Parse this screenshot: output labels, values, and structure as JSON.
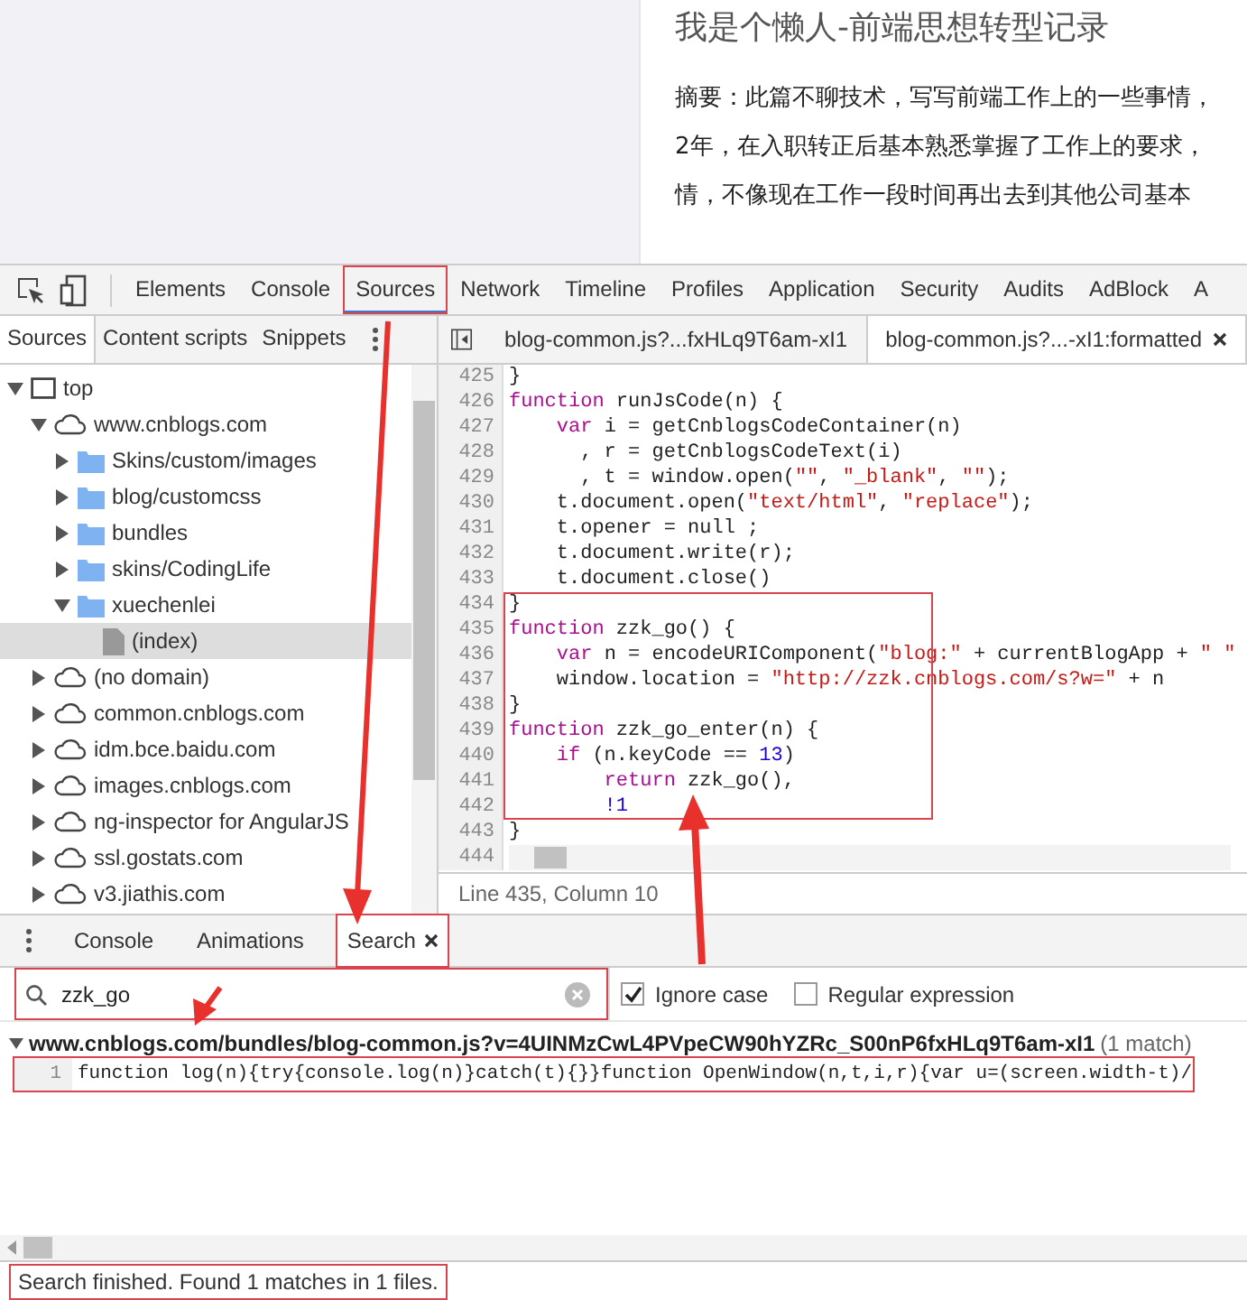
{
  "article": {
    "title": "我是个懒人-前端思想转型记录",
    "summary_lines": [
      "摘要：此篇不聊技术，写写前端工作上的一些事情，",
      "2年，在入职转正后基本熟悉掌握了工作上的要求，",
      "情，不像现在工作一段时间再出去到其他公司基本"
    ]
  },
  "panel_tabs": [
    {
      "label": "Elements",
      "selected": false,
      "highlighted": false
    },
    {
      "label": "Console",
      "selected": false,
      "highlighted": false
    },
    {
      "label": "Sources",
      "selected": true,
      "highlighted": true
    },
    {
      "label": "Network",
      "selected": false,
      "highlighted": false
    },
    {
      "label": "Timeline",
      "selected": false,
      "highlighted": false
    },
    {
      "label": "Profiles",
      "selected": false,
      "highlighted": false
    },
    {
      "label": "Application",
      "selected": false,
      "highlighted": false
    },
    {
      "label": "Security",
      "selected": false,
      "highlighted": false
    },
    {
      "label": "Audits",
      "selected": false,
      "highlighted": false
    },
    {
      "label": "AdBlock",
      "selected": false,
      "highlighted": false
    },
    {
      "label": "A",
      "selected": false,
      "highlighted": false
    }
  ],
  "navigator_tabs": [
    {
      "label": "Sources",
      "selected": true
    },
    {
      "label": "Content scripts",
      "selected": false
    },
    {
      "label": "Snippets",
      "selected": false
    }
  ],
  "editor_tabs": [
    {
      "label": "blog-common.js?...fxHLq9T6am-xI1",
      "selected": false,
      "closable": false
    },
    {
      "label": "blog-common.js?...-xI1:formatted",
      "selected": true,
      "closable": true
    }
  ],
  "tree": [
    {
      "label": "top",
      "kind": "frame",
      "expanded": true,
      "selected": false,
      "children": [
        {
          "label": "www.cnblogs.com",
          "kind": "domain",
          "expanded": true,
          "selected": false,
          "children": [
            {
              "label": "Skins/custom/images",
              "kind": "folder",
              "expanded": false,
              "selected": false
            },
            {
              "label": "blog/customcss",
              "kind": "folder",
              "expanded": false,
              "selected": false
            },
            {
              "label": "bundles",
              "kind": "folder",
              "expanded": false,
              "selected": false
            },
            {
              "label": "skins/CodingLife",
              "kind": "folder",
              "expanded": false,
              "selected": false
            },
            {
              "label": "xuechenlei",
              "kind": "folder",
              "expanded": true,
              "selected": false,
              "children": [
                {
                  "label": "(index)",
                  "kind": "file",
                  "selected": true
                }
              ]
            }
          ]
        },
        {
          "label": "(no domain)",
          "kind": "domain",
          "expanded": false,
          "selected": false
        },
        {
          "label": "common.cnblogs.com",
          "kind": "domain",
          "expanded": false,
          "selected": false
        },
        {
          "label": "idm.bce.baidu.com",
          "kind": "domain",
          "expanded": false,
          "selected": false
        },
        {
          "label": "images.cnblogs.com",
          "kind": "domain",
          "expanded": false,
          "selected": false
        },
        {
          "label": "ng-inspector for AngularJS",
          "kind": "domain",
          "expanded": false,
          "selected": false
        },
        {
          "label": "ssl.gostats.com",
          "kind": "domain",
          "expanded": false,
          "selected": false
        },
        {
          "label": "v3.jiathis.com",
          "kind": "domain",
          "expanded": false,
          "selected": false
        }
      ]
    }
  ],
  "code_lines": [
    {
      "number": "425",
      "highlighted": false,
      "tokens": [
        {
          "kind": "plain",
          "text": "}"
        }
      ]
    },
    {
      "number": "426",
      "highlighted": false,
      "tokens": [
        {
          "kind": "keyword",
          "text": "function"
        },
        {
          "kind": "plain",
          "text": " runJsCode(n) {"
        }
      ]
    },
    {
      "number": "427",
      "highlighted": false,
      "tokens": [
        {
          "kind": "keyword",
          "text": "    var"
        },
        {
          "kind": "plain",
          "text": " i = getCnblogsCodeContainer(n)"
        }
      ]
    },
    {
      "number": "428",
      "highlighted": false,
      "tokens": [
        {
          "kind": "plain",
          "text": "      , r = getCnblogsCodeText(i)"
        }
      ]
    },
    {
      "number": "429",
      "highlighted": false,
      "tokens": [
        {
          "kind": "plain",
          "text": "      , t = window.open("
        },
        {
          "kind": "string",
          "text": "\"\""
        },
        {
          "kind": "plain",
          "text": ", "
        },
        {
          "kind": "string",
          "text": "\"_blank\""
        },
        {
          "kind": "plain",
          "text": ", "
        },
        {
          "kind": "string",
          "text": "\"\""
        },
        {
          "kind": "plain",
          "text": ");"
        }
      ]
    },
    {
      "number": "430",
      "highlighted": false,
      "tokens": [
        {
          "kind": "plain",
          "text": "    t.document.open("
        },
        {
          "kind": "string",
          "text": "\"text/html\""
        },
        {
          "kind": "plain",
          "text": ", "
        },
        {
          "kind": "string",
          "text": "\"replace\""
        },
        {
          "kind": "plain",
          "text": ");"
        }
      ]
    },
    {
      "number": "431",
      "highlighted": false,
      "tokens": [
        {
          "kind": "plain",
          "text": "    t.opener = null ;"
        }
      ]
    },
    {
      "number": "432",
      "highlighted": false,
      "tokens": [
        {
          "kind": "plain",
          "text": "    t.document.write(r);"
        }
      ]
    },
    {
      "number": "433",
      "highlighted": false,
      "tokens": [
        {
          "kind": "plain",
          "text": "    t.document.close()"
        }
      ]
    },
    {
      "number": "434",
      "highlighted": true,
      "tokens": [
        {
          "kind": "plain",
          "text": "}"
        }
      ]
    },
    {
      "number": "435",
      "highlighted": true,
      "tokens": [
        {
          "kind": "keyword",
          "text": "function"
        },
        {
          "kind": "plain",
          "text": " zzk_go() {"
        }
      ]
    },
    {
      "number": "436",
      "highlighted": true,
      "tokens": [
        {
          "kind": "keyword",
          "text": "    var"
        },
        {
          "kind": "plain",
          "text": " n = encodeURIComponent("
        },
        {
          "kind": "string",
          "text": "\"blog:\""
        },
        {
          "kind": "plain",
          "text": " + currentBlogApp + "
        },
        {
          "kind": "string",
          "text": "\" \""
        }
      ]
    },
    {
      "number": "437",
      "highlighted": true,
      "tokens": [
        {
          "kind": "plain",
          "text": "    window.location = "
        },
        {
          "kind": "string",
          "text": "\"http://zzk.cnblogs.com/s?w=\""
        },
        {
          "kind": "plain",
          "text": " + n"
        }
      ]
    },
    {
      "number": "438",
      "highlighted": true,
      "tokens": [
        {
          "kind": "plain",
          "text": "}"
        }
      ]
    },
    {
      "number": "439",
      "highlighted": true,
      "tokens": [
        {
          "kind": "keyword",
          "text": "function"
        },
        {
          "kind": "plain",
          "text": " zzk_go_enter(n) {"
        }
      ]
    },
    {
      "number": "440",
      "highlighted": true,
      "tokens": [
        {
          "kind": "keyword",
          "text": "    if"
        },
        {
          "kind": "plain",
          "text": " (n.keyCode == "
        },
        {
          "kind": "number",
          "text": "13"
        },
        {
          "kind": "plain",
          "text": ")"
        }
      ]
    },
    {
      "number": "441",
      "highlighted": true,
      "tokens": [
        {
          "kind": "keyword",
          "text": "        return"
        },
        {
          "kind": "plain",
          "text": " zzk_go(),"
        }
      ]
    },
    {
      "number": "442",
      "highlighted": true,
      "tokens": [
        {
          "kind": "number",
          "text": "        !1"
        }
      ]
    },
    {
      "number": "443",
      "highlighted": false,
      "tokens": [
        {
          "kind": "plain",
          "text": "}"
        }
      ]
    },
    {
      "number": "444",
      "highlighted": false
    }
  ],
  "editor_status": "Line 435, Column 10",
  "drawer_tabs": [
    {
      "label": "Console",
      "selected": false,
      "closable": false,
      "highlighted": false
    },
    {
      "label": "Animations",
      "selected": false,
      "closable": false,
      "highlighted": false
    },
    {
      "label": "Search",
      "selected": true,
      "closable": true,
      "highlighted": true
    }
  ],
  "search": {
    "value": "zzk_go",
    "highlighted": true,
    "ignore_case": {
      "label": "Ignore case",
      "checked": true
    },
    "regular_expression": {
      "label": "Regular expression",
      "checked": false
    }
  },
  "results": [
    {
      "file": "www.cnblogs.com/bundles/blog-common.js?v=4UINMzCwL4PVpeCW90hYZRc_S00nP6fxHLq9T6am-xI1",
      "count": "(1 match)",
      "expanded": true,
      "matches": [
        {
          "line": "1",
          "text": "function log(n){try{console.log(n)}catch(t){}}function OpenWindow(n,t,i,r){var u=(screen.width-t)/",
          "highlighted": true
        }
      ]
    }
  ],
  "status": {
    "text": "Search finished.  Found 1 matches in 1 files.",
    "highlighted": true
  }
}
